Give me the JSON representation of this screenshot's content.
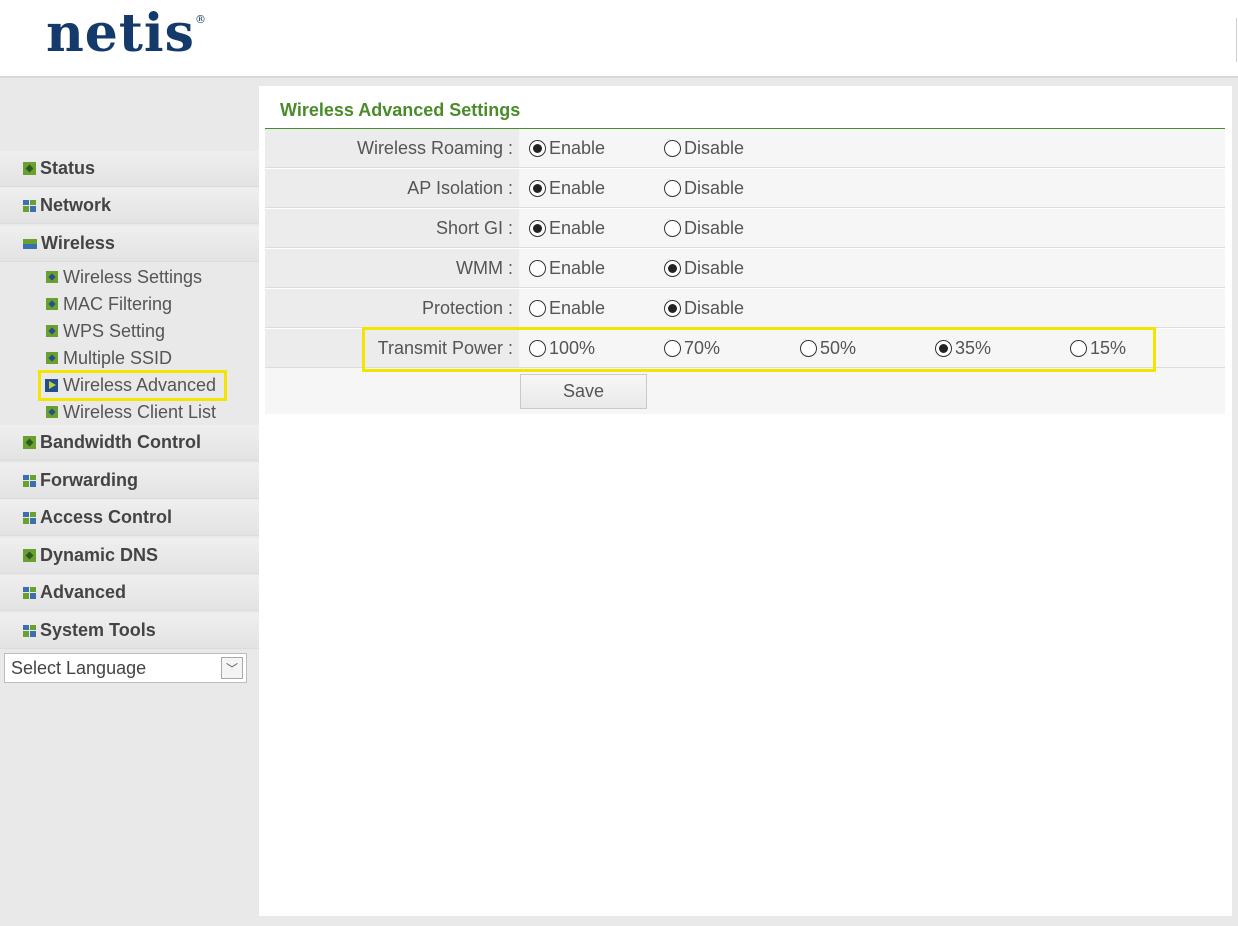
{
  "brand": {
    "logo": "netis",
    "reg": "®"
  },
  "sidebar": {
    "items": [
      {
        "label": "Status",
        "icon": "diamond-icon"
      },
      {
        "label": "Network",
        "icon": "grid-icon"
      },
      {
        "label": "Wireless",
        "icon": "bar-icon"
      },
      {
        "label": "Bandwidth Control",
        "icon": "diamond-icon"
      },
      {
        "label": "Forwarding",
        "icon": "grid-icon"
      },
      {
        "label": "Access Control",
        "icon": "grid-icon"
      },
      {
        "label": "Dynamic DNS",
        "icon": "diamond-icon"
      },
      {
        "label": "Advanced",
        "icon": "grid-icon"
      },
      {
        "label": "System Tools",
        "icon": "grid-icon"
      }
    ],
    "subitems": [
      {
        "label": "Wireless Settings"
      },
      {
        "label": "MAC Filtering"
      },
      {
        "label": "WPS Setting"
      },
      {
        "label": "Multiple SSID"
      },
      {
        "label": "Wireless Advanced",
        "active": true
      },
      {
        "label": "Wireless Client List"
      }
    ],
    "language": {
      "label": "Select Language",
      "arrow": "﹀"
    }
  },
  "page": {
    "title": "Wireless Advanced Settings",
    "rows": [
      {
        "label": "Wireless Roaming :",
        "options": [
          "Enable",
          "Disable"
        ],
        "selected": "Enable"
      },
      {
        "label": "AP Isolation :",
        "options": [
          "Enable",
          "Disable"
        ],
        "selected": "Enable"
      },
      {
        "label": "Short GI :",
        "options": [
          "Enable",
          "Disable"
        ],
        "selected": "Enable"
      },
      {
        "label": "WMM :",
        "options": [
          "Enable",
          "Disable"
        ],
        "selected": "Disable"
      },
      {
        "label": "Protection :",
        "options": [
          "Enable",
          "Disable"
        ],
        "selected": "Disable"
      },
      {
        "label": "Transmit Power :",
        "options": [
          "100%",
          "70%",
          "50%",
          "35%",
          "15%"
        ],
        "selected": "35%"
      }
    ],
    "save_label": "Save"
  },
  "colors": {
    "accent_green": "#4a8c2a",
    "highlight_yellow": "#f2e600",
    "logo_blue": "#143a6b"
  }
}
